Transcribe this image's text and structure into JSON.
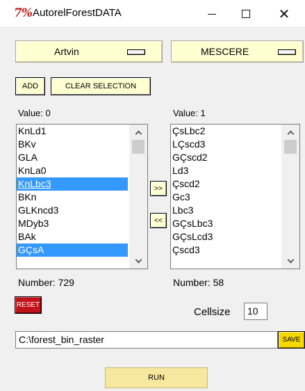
{
  "window": {
    "icon_text": "7%",
    "title": "AutorelForestDATA",
    "minimize_glyph": "—",
    "maximize_glyph": "☐",
    "close_glyph": "✕"
  },
  "left_panel": {
    "dropdown_value": "Artvin",
    "value_label": "Value: 0",
    "items": [
      "KnLd1",
      "BKv",
      "GLA",
      "KnLa0",
      "KnLbc3",
      "BKn",
      "GLKncd3",
      "MDyb3",
      "BAk",
      "GÇsA"
    ],
    "selected_indices": [
      4,
      9
    ],
    "active_index": 4,
    "number_label": "Number: 729"
  },
  "right_panel": {
    "dropdown_value": "MESCERE",
    "value_label": "Value: 1",
    "items": [
      "ÇsLbc2",
      "LÇscd3",
      "GÇscd2",
      "Ld3",
      "Çscd2",
      "Gc3",
      "Lbc3",
      "GÇsLbc3",
      "GÇsLcd3",
      "Çscd3"
    ],
    "number_label": "Number: 58"
  },
  "buttons": {
    "add": "ADD",
    "clear_selection": "CLEAR SELECTION",
    "move_right": ">>",
    "move_left": "<<",
    "reset": "RESET",
    "save": "SAVE",
    "run": "RUN"
  },
  "cellsize": {
    "label": "Cellsize",
    "value": "10"
  },
  "output_path": "C:\\forest_bin_raster",
  "colors": {
    "button_bg": "#ffffd2",
    "selection": "#3399ff",
    "reset_bg": "#c1121b",
    "save_bg": "#f5d800",
    "run_bg": "#f7e8a0",
    "app_icon": "#c21b1b"
  }
}
